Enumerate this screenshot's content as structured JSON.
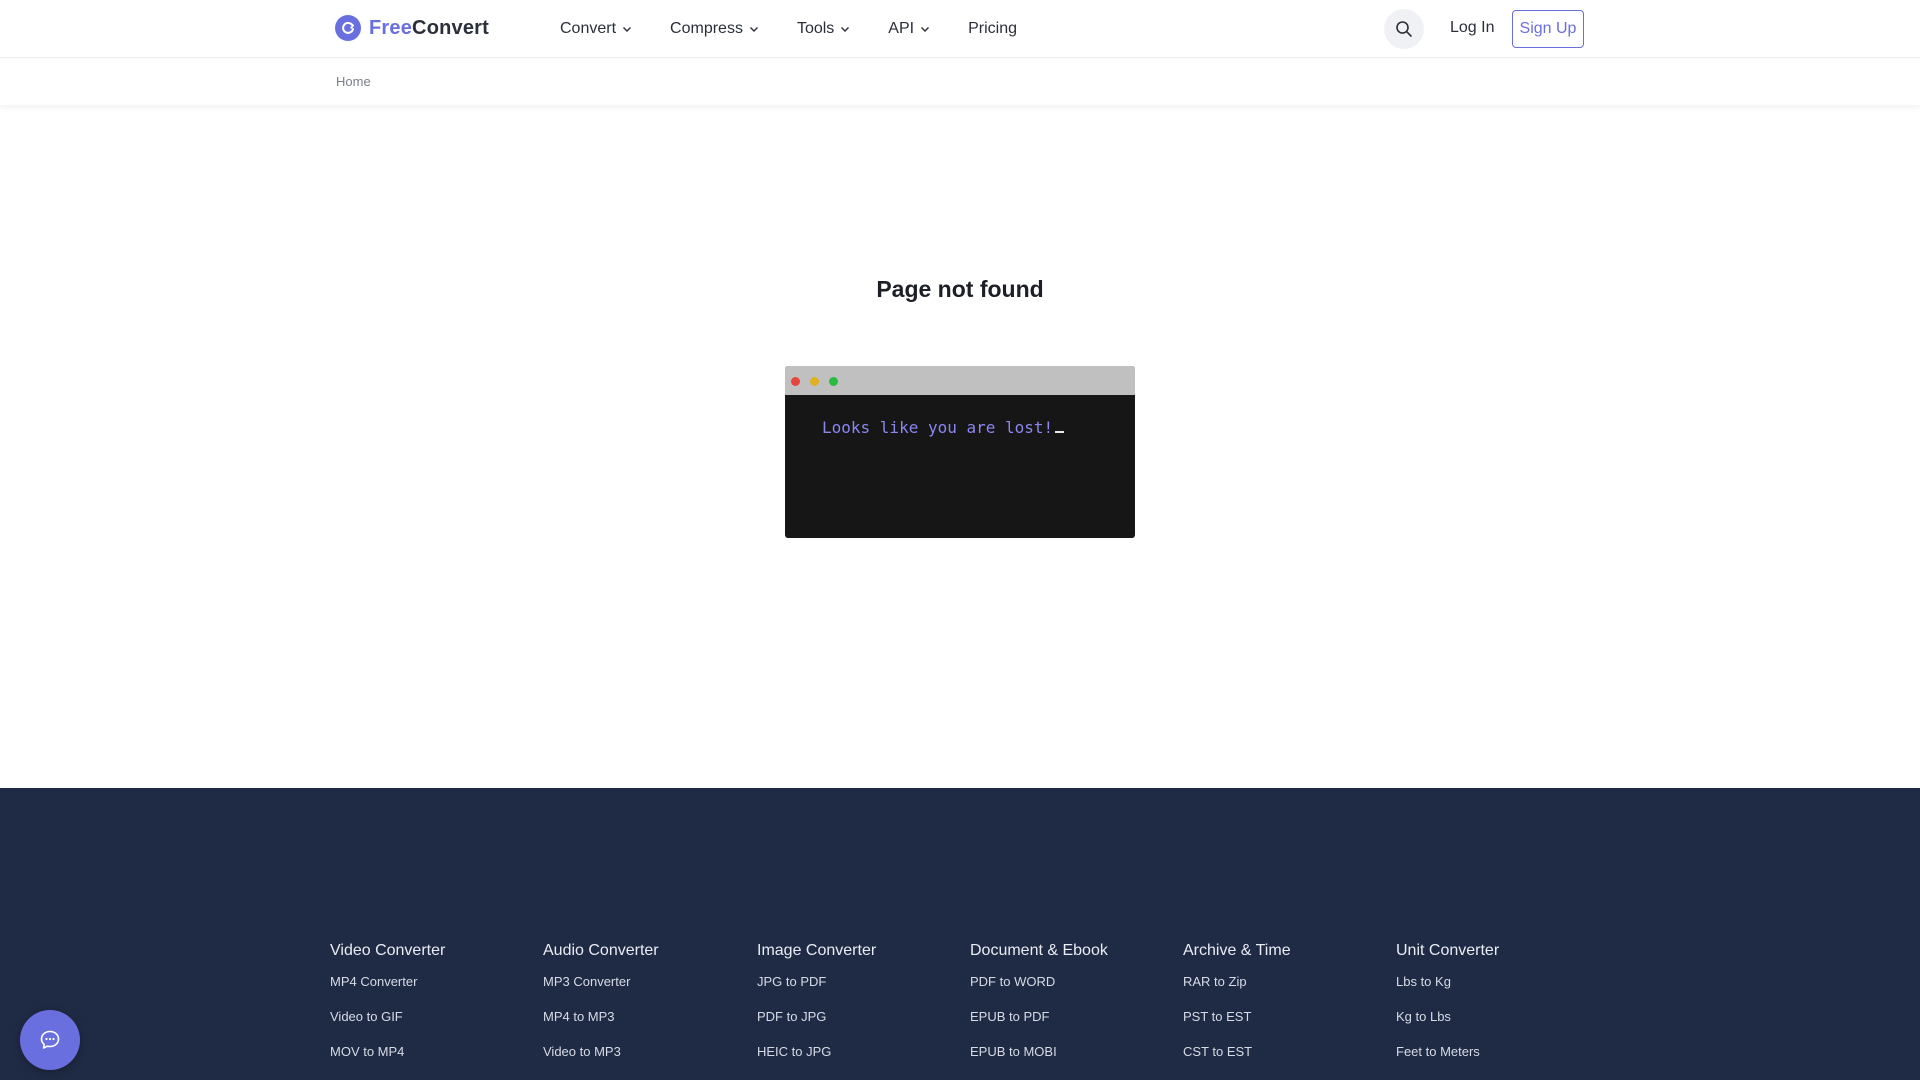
{
  "header": {
    "logo": {
      "part1": "Free",
      "part2": "Convert",
      "icon": "refresh-icon"
    },
    "nav": [
      {
        "label": "Convert",
        "has_dropdown": true
      },
      {
        "label": "Compress",
        "has_dropdown": true
      },
      {
        "label": "Tools",
        "has_dropdown": true
      },
      {
        "label": "API",
        "has_dropdown": true
      },
      {
        "label": "Pricing",
        "has_dropdown": false
      }
    ],
    "search_icon": "search-icon",
    "login_label": "Log In",
    "signup_label": "Sign Up"
  },
  "breadcrumb": {
    "home": "Home"
  },
  "main": {
    "title": "Page not found",
    "terminal_text": "Looks like you are lost!"
  },
  "footer": {
    "columns": [
      {
        "heading": "Video Converter",
        "links": [
          "MP4 Converter",
          "Video to GIF",
          "MOV to MP4"
        ]
      },
      {
        "heading": "Audio Converter",
        "links": [
          "MP3 Converter",
          "MP4 to MP3",
          "Video to MP3"
        ]
      },
      {
        "heading": "Image Converter",
        "links": [
          "JPG to PDF",
          "PDF to JPG",
          "HEIC to JPG"
        ]
      },
      {
        "heading": "Document & Ebook",
        "links": [
          "PDF to WORD",
          "EPUB to PDF",
          "EPUB to MOBI"
        ]
      },
      {
        "heading": "Archive & Time",
        "links": [
          "RAR to Zip",
          "PST to EST",
          "CST to EST"
        ]
      },
      {
        "heading": "Unit Converter",
        "links": [
          "Lbs to Kg",
          "Kg to Lbs",
          "Feet to Meters"
        ]
      }
    ]
  },
  "chat": {
    "icon": "chat-bubble-icon"
  },
  "colors": {
    "brand": "#6a6fe0",
    "footer_bg": "#1f2a44",
    "terminal_bg": "#161616",
    "terminal_text": "#8b86f0"
  }
}
